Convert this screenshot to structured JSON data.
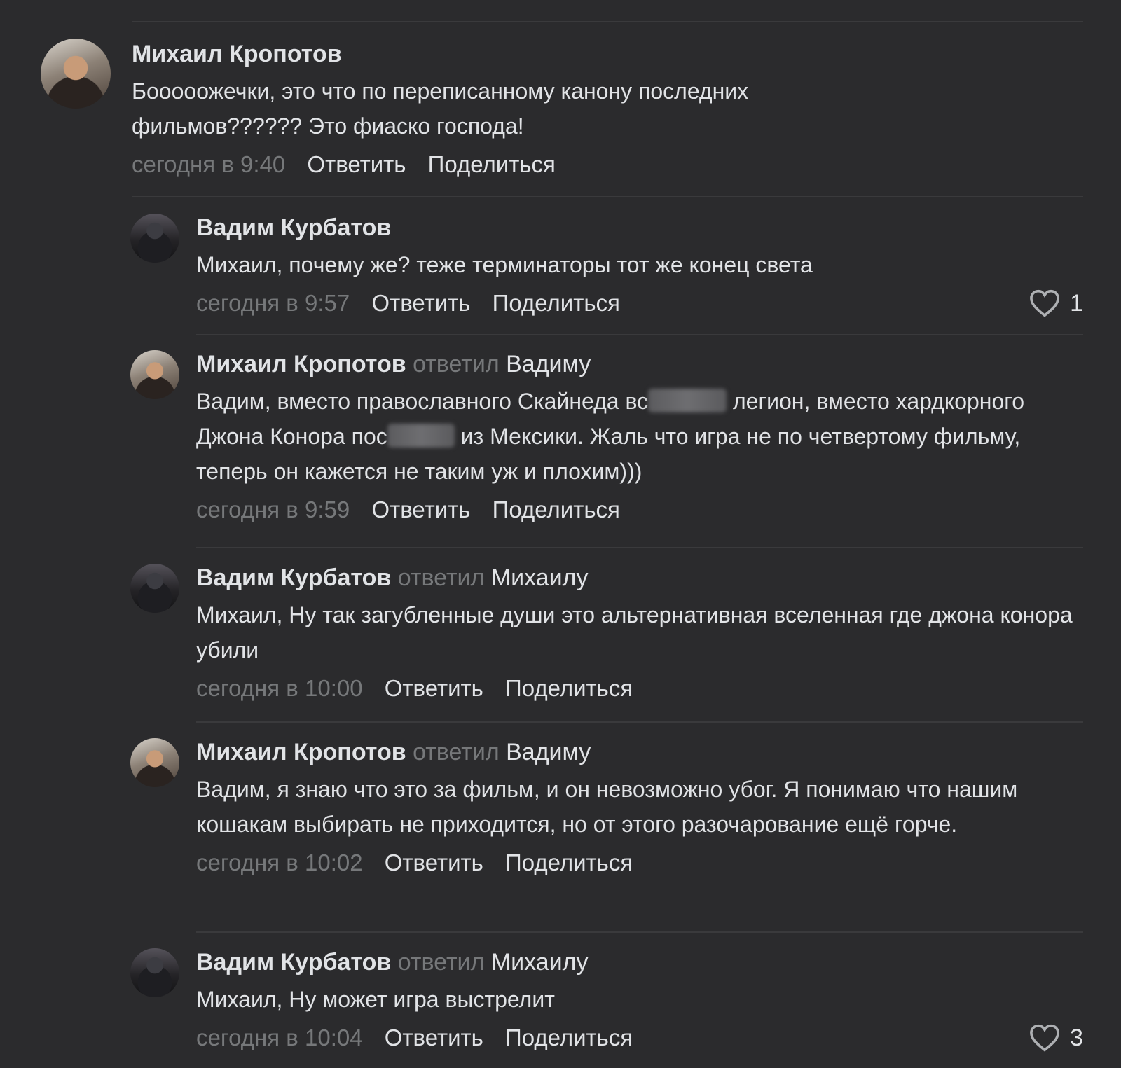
{
  "labels": {
    "replied": "ответил",
    "reply": "Ответить",
    "share": "Поделиться"
  },
  "comments": [
    {
      "author": "Михаил Кропотов",
      "text": "Бооооожечки, это что по переписанному канону последних фильмов?????? Это фиаско господа!",
      "time": "сегодня в 9:40"
    },
    {
      "author": "Вадим Курбатов",
      "text": "Михаил, почему же? теже терминаторы тот же конец света",
      "time": "сегодня в 9:57",
      "likes": "1"
    },
    {
      "author": "Михаил Кропотов",
      "reply_to": "Вадиму",
      "text_parts": [
        "Вадим, вместо православного Скайнеда вс",
        "легион, вместо хардкорного Джона Конора пос",
        "из Мексики. Жаль что игра не по четвертому фильму, теперь он кажется не таким уж и плохим)))"
      ],
      "time": "сегодня в 9:59"
    },
    {
      "author": "Вадим Курбатов",
      "reply_to": "Михаилу",
      "text": "Михаил, Ну так загубленные души это альтернативная вселенная где джона конора убили",
      "time": "сегодня в 10:00"
    },
    {
      "author": "Михаил Кропотов",
      "reply_to": "Вадиму",
      "text": "Вадим, я знаю что это за фильм, и он невозможно убог. Я понимаю что нашим кошакам выбирать не приходится, но от этого разочарование ещё горче.",
      "time": "сегодня в 10:02"
    },
    {
      "author": "Вадим Курбатов",
      "reply_to": "Михаилу",
      "text": "Михаил, Ну может игра выстрелит",
      "time": "сегодня в 10:04",
      "likes": "3"
    }
  ]
}
